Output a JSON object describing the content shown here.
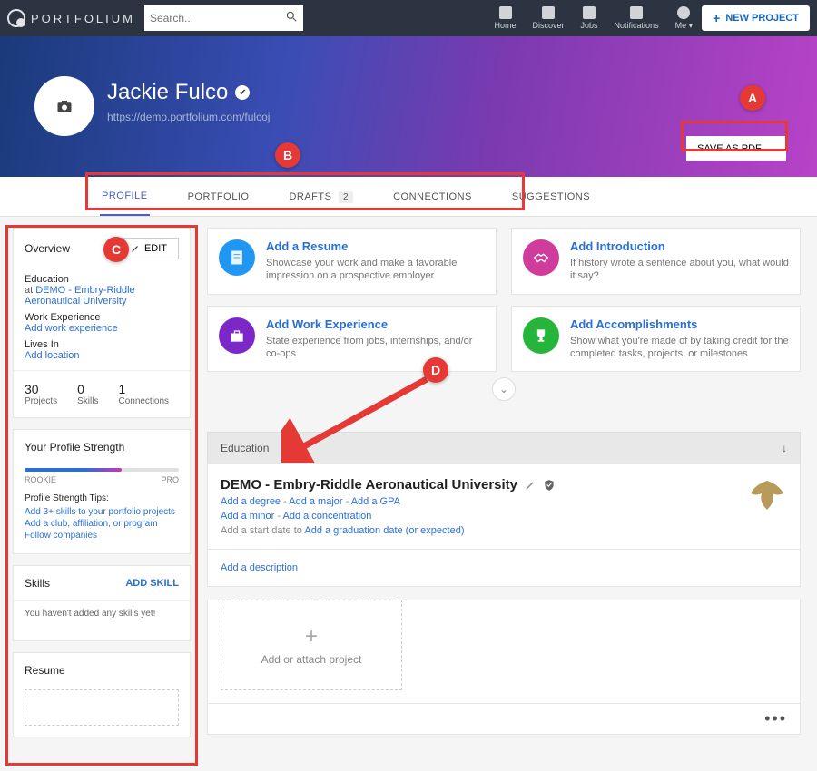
{
  "brand": "PORTFOLIUM",
  "search": {
    "placeholder": "Search..."
  },
  "nav": {
    "home": "Home",
    "discover": "Discover",
    "jobs": "Jobs",
    "notifications": "Notifications",
    "me": "Me",
    "new_project": "NEW PROJECT"
  },
  "profile": {
    "name": "Jackie Fulco",
    "url": "https://demo.portfolium.com/fulcoj",
    "save_pdf": "SAVE AS PDF"
  },
  "tabs": {
    "profile": "PROFILE",
    "portfolio": "PORTFOLIO",
    "drafts": "DRAFTS",
    "drafts_count": "2",
    "connections": "CONNECTIONS",
    "suggestions": "SUGGESTIONS"
  },
  "overview": {
    "title": "Overview",
    "edit": "EDIT",
    "education_label": "Education",
    "education_prefix": "at ",
    "education_link": "DEMO - Embry-Riddle Aeronautical University",
    "work_label": "Work Experience",
    "work_link": "Add work experience",
    "lives_label": "Lives In",
    "lives_link": "Add location",
    "stats": {
      "projects_n": "30",
      "projects_l": "Projects",
      "skills_n": "0",
      "skills_l": "Skills",
      "conn_n": "1",
      "conn_l": "Connections"
    }
  },
  "strength": {
    "title": "Your Profile Strength",
    "rookie": "ROOKIE",
    "pro": "PRO",
    "tips_title": "Profile Strength Tips:",
    "tip1": "Add 3+ skills to your portfolio projects",
    "tip2": "Add a club, affiliation, or program",
    "tip3": "Follow companies"
  },
  "skills": {
    "title": "Skills",
    "add": "ADD SKILL",
    "empty": "You haven't added any skills yet!"
  },
  "resume": {
    "title": "Resume"
  },
  "promos": {
    "resume": {
      "title": "Add a Resume",
      "desc": "Showcase your work and make a favorable impression on a prospective employer."
    },
    "intro": {
      "title": "Add Introduction",
      "desc": "If history wrote a sentence about you, what would it say?"
    },
    "work": {
      "title": "Add Work Experience",
      "desc": "State experience from jobs, internships, and/or co-ops"
    },
    "accom": {
      "title": "Add Accomplishments",
      "desc": "Show what you're made of by taking credit for the completed tasks, projects, or milestones"
    }
  },
  "education": {
    "header": "Education",
    "school": "DEMO - Embry-Riddle Aeronautical University",
    "add_degree": "Add a degree",
    "add_major": "Add a major",
    "add_gpa": "Add a GPA",
    "add_minor": "Add a minor",
    "add_conc": "Add a concentration",
    "add_start": "Add a start date",
    "to": " to ",
    "add_grad": "Add a graduation date (or expected)",
    "add_desc": "Add a description",
    "add_proj": "Add or attach project"
  },
  "annotations": {
    "A": "A",
    "B": "B",
    "C": "C",
    "D": "D"
  }
}
